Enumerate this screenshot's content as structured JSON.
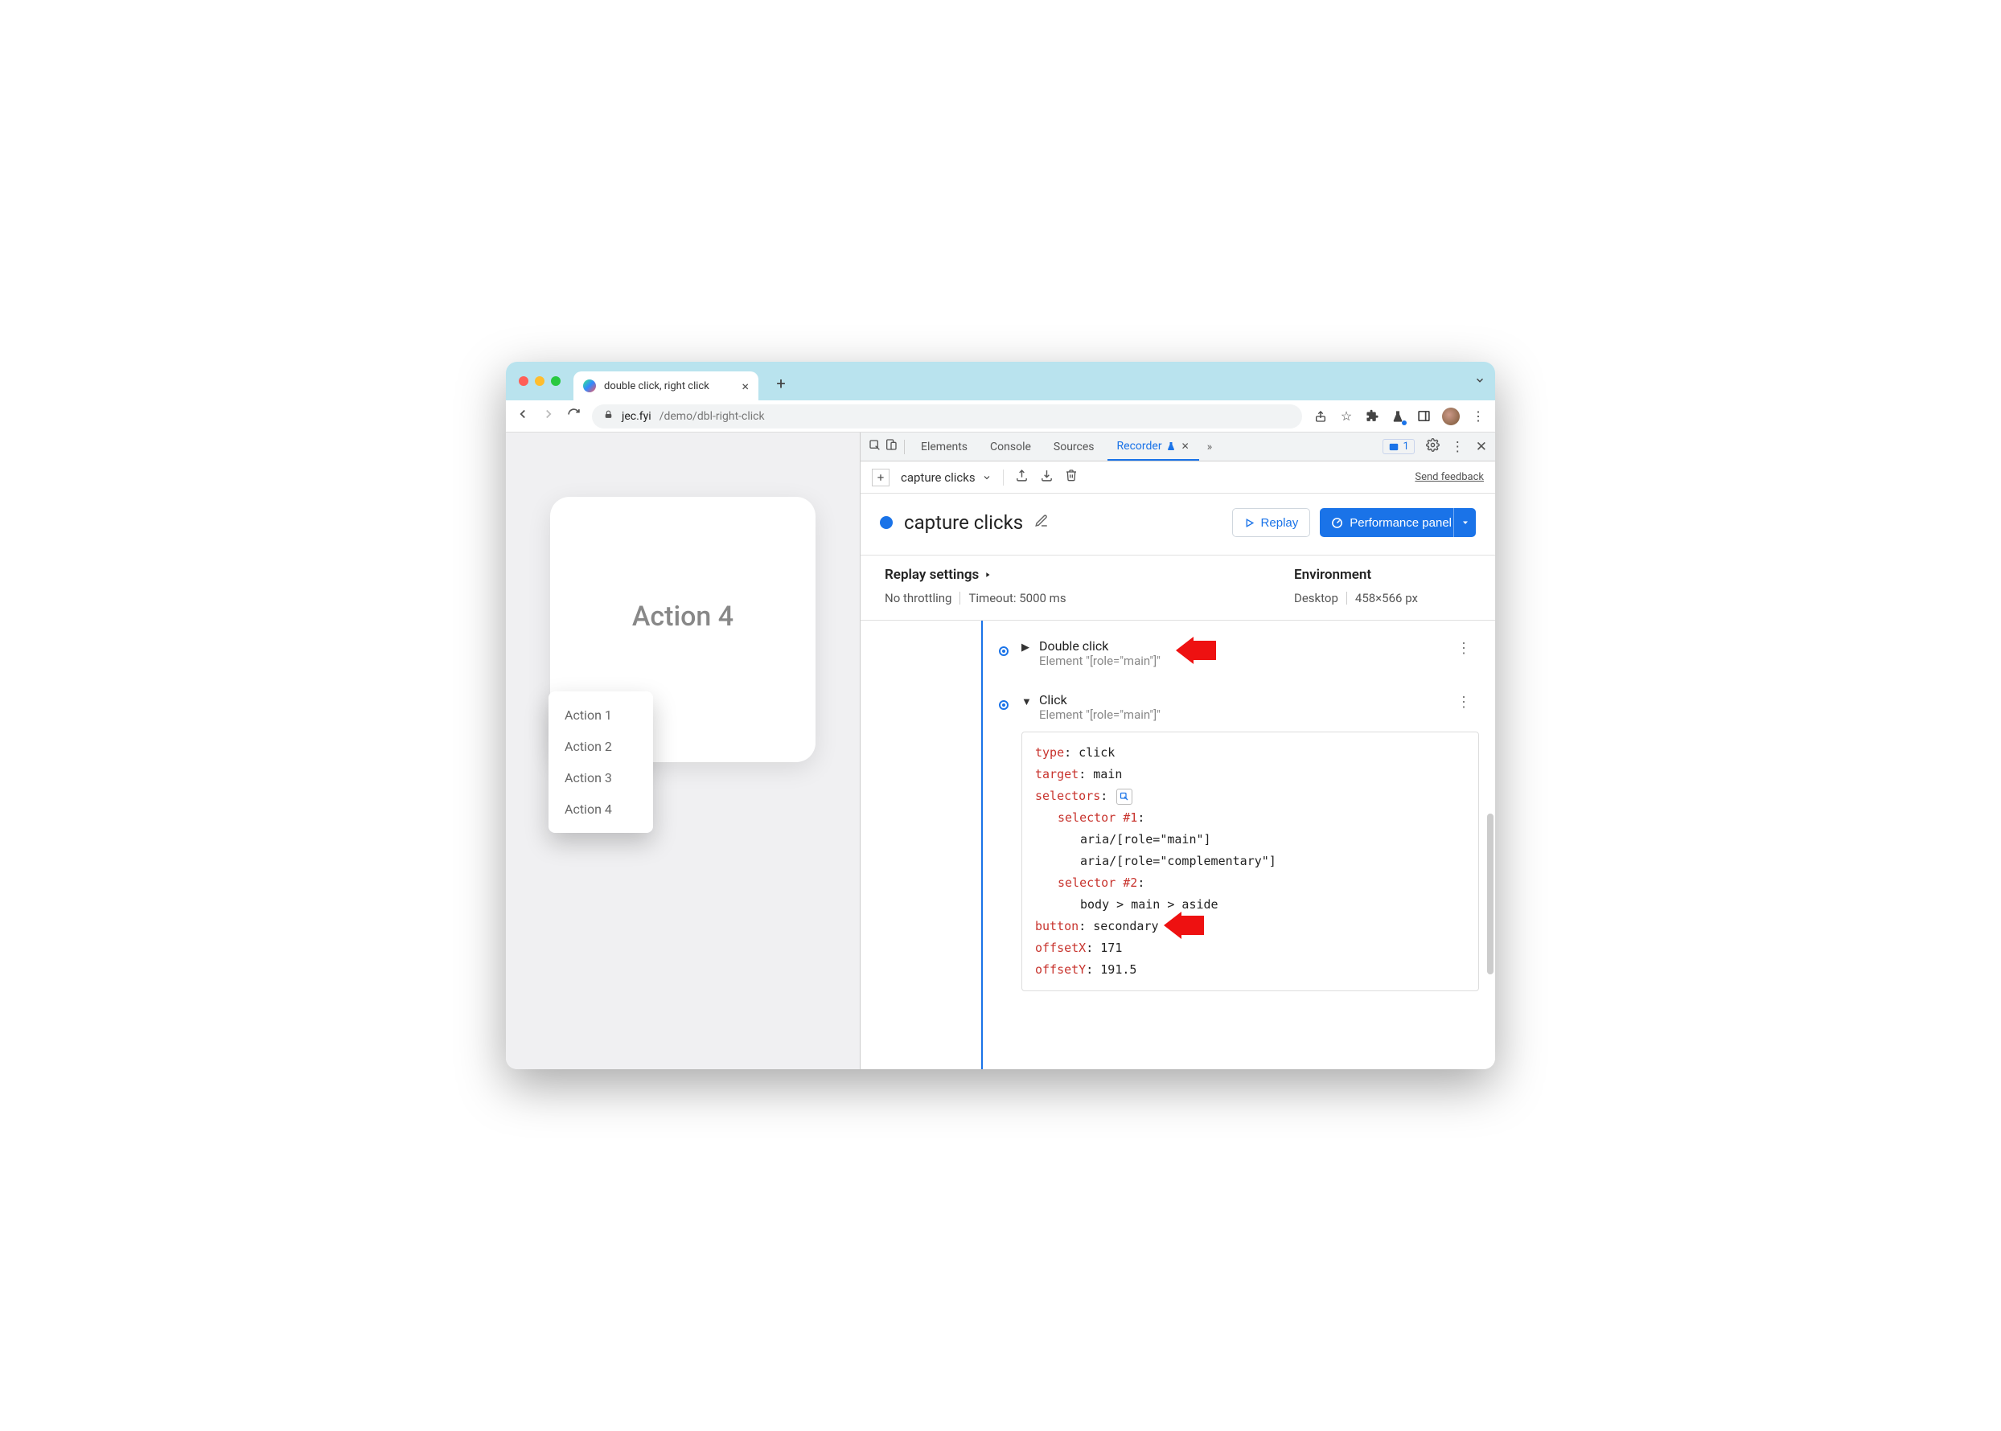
{
  "window": {
    "tab_title": "double click, right click",
    "traffic": {
      "close": "close",
      "min": "minimize",
      "max": "zoom"
    }
  },
  "nav": {
    "url_domain": "jec.fyi",
    "url_path": "/demo/dbl-right-click"
  },
  "page": {
    "card_title": "Action 4",
    "context_menu": [
      "Action 1",
      "Action 2",
      "Action 3",
      "Action 4"
    ]
  },
  "devtools": {
    "tabs": {
      "elements": "Elements",
      "console": "Console",
      "sources": "Sources",
      "recorder": "Recorder"
    },
    "issues_count": "1"
  },
  "recorder_toolbar": {
    "recording_name": "capture clicks",
    "send_feedback": "Send feedback"
  },
  "recorder_header": {
    "title": "capture clicks",
    "replay_btn": "Replay",
    "perf_btn": "Performance panel"
  },
  "settings": {
    "replay_label": "Replay settings",
    "throttling": "No throttling",
    "timeout": "Timeout: 5000 ms",
    "env_label": "Environment",
    "device": "Desktop",
    "viewport": "458×566 px"
  },
  "steps": {
    "s1": {
      "title": "Double click",
      "sub": "Element \"[role=\"main\"]\""
    },
    "s2": {
      "title": "Click",
      "sub": "Element \"[role=\"main\"]\""
    },
    "detail": {
      "type_k": "type",
      "type_v": ": click",
      "target_k": "target",
      "target_v": ": main",
      "selectors_k": "selectors",
      "selectors_v": ":",
      "sel1_k": "selector #1",
      "sel1_v": ":",
      "sel1_a": "aria/[role=\"main\"]",
      "sel1_b": "aria/[role=\"complementary\"]",
      "sel2_k": "selector #2",
      "sel2_v": ":",
      "sel2_a": "body > main > aside",
      "button_k": "button",
      "button_v": ": secondary",
      "ox_k": "offsetX",
      "ox_v": ": 171",
      "oy_k": "offsetY",
      "oy_v": ": 191.5"
    }
  }
}
